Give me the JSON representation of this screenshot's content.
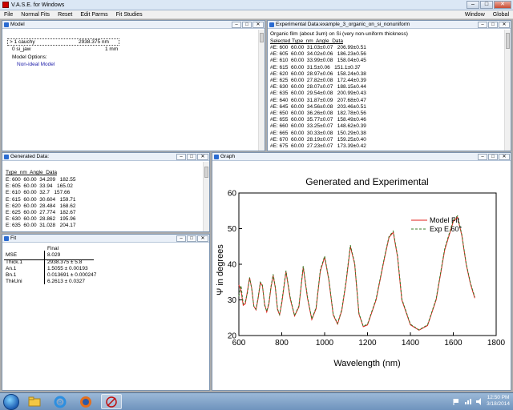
{
  "app": {
    "title": "V.A.S.E. for Windows",
    "min_label": "–",
    "max_label": "□",
    "close_label": "✕"
  },
  "menu": {
    "items": [
      "File",
      "Normal Fits",
      "Reset",
      "Edit Parms",
      "Fit Studies"
    ],
    "right": [
      "Window",
      "Global"
    ]
  },
  "pane_buttons": {
    "min": "–",
    "max": "□",
    "close": "✕"
  },
  "model": {
    "title": "Model",
    "rows": [
      {
        "label": "> 1 cauchy",
        "value": "2938.375 nm"
      },
      {
        "label": "0 si_jaw",
        "value": "1 mm"
      }
    ],
    "options_label": "Model Options:",
    "option": "Non-ideal Model"
  },
  "experimental": {
    "title": "Experimental Data:example_3_organic_on_si_nonuniform",
    "subtitle": "Organic film (about 3um) on Si (very non-uniform thickness)",
    "header": "Selected Type  nm  Angle  Data",
    "rows": [
      "#E: 600  60.00  31.03±0.07   206.99±0.51",
      "#E: 605  60.00  34.02±0.06   186.23±0.56",
      "#E: 610  60.00  33.99±0.08   158.04±0.45",
      "#E: 615  60.00  31.5±0.06   151.1±0.37",
      "#E: 620  60.00  28.97±0.06   158.24±0.38",
      "#E: 625  60.00  27.82±0.08   172.44±0.39",
      "#E: 630  60.00  28.07±0.07   188.15±0.44",
      "#E: 635  60.00  29.54±0.08   200.99±0.43",
      "#E: 640  60.00  31.87±0.09   207.68±0.47",
      "#E: 645  60.00  34.56±0.08   203.46±0.51",
      "#E: 650  60.00  36.26±0.08   182.78±0.56",
      "#E: 655  60.00  35.77±0.07   158.49±0.46",
      "#E: 660  60.00  33.25±0.07   148.62±0.39",
      "#E: 665  60.00  30.33±0.08   150.29±0.38",
      "#E: 670  60.00  28.19±0.07   159.25±0.40",
      "#E: 675  60.00  27.23±0.07   173.39±0.42"
    ]
  },
  "generated": {
    "title": "Generated Data:",
    "header": "Type  nm  Angle  Data",
    "rows": [
      "E: 600  60.00  34.209   182.55",
      "E: 605  60.00  33.94   165.02",
      "E: 610  60.00  32.7   157.66",
      "E: 615  60.00  30.604   159.71",
      "E: 620  60.00  28.484   168.62",
      "E: 625  60.00  27.774   182.67",
      "E: 630  60.00  28.862   195.96",
      "E: 635  60.00  31.028   204.17"
    ]
  },
  "fit": {
    "title": "Fit",
    "col_header": "Final",
    "rows": [
      {
        "name": "MSE",
        "value": "8.029"
      },
      {
        "name": "Thick.1",
        "value": "2938.375 ± 5.8"
      },
      {
        "name": "An.1",
        "value": "1.5055 ± 0.00193"
      },
      {
        "name": "Bn.1",
        "value": "0.013691 ± 0.000247"
      },
      {
        "name": "ThkUni",
        "value": "6.2613 ± 0.0327"
      }
    ]
  },
  "graph": {
    "title": "Graph"
  },
  "chart_data": {
    "type": "line",
    "title": "Generated and Experimental",
    "xlabel": "Wavelength (nm)",
    "ylabel": "Ψ in degrees",
    "xlim": [
      600,
      1800
    ],
    "ylim": [
      20,
      60
    ],
    "xticks": [
      600,
      800,
      1000,
      1200,
      1400,
      1600,
      1800
    ],
    "yticks": [
      20,
      30,
      40,
      50,
      60
    ],
    "legend_position": "right",
    "series": [
      {
        "name": "Model Fit",
        "style": "solid",
        "color": "#e0201c",
        "x": [
          600,
          610,
          620,
          630,
          640,
          650,
          660,
          670,
          680,
          690,
          700,
          710,
          720,
          730,
          740,
          750,
          760,
          770,
          780,
          790,
          800,
          820,
          840,
          860,
          880,
          900,
          920,
          940,
          960,
          980,
          1000,
          1020,
          1040,
          1060,
          1080,
          1100,
          1120,
          1140,
          1160,
          1180,
          1200,
          1240,
          1280,
          1300,
          1320,
          1340,
          1360,
          1400,
          1440,
          1480,
          1520,
          1560,
          1600,
          1620,
          1640,
          1660,
          1680,
          1700
        ],
        "y": [
          34.2,
          32.7,
          28.5,
          28.9,
          32.5,
          36.2,
          33.3,
          28.2,
          27.2,
          30.5,
          34.8,
          33.9,
          28.8,
          26.6,
          28.9,
          33.5,
          36.8,
          33.4,
          27.3,
          25.8,
          29,
          37.9,
          30.2,
          25.5,
          28,
          39.2,
          30.5,
          24.5,
          27.5,
          38,
          42,
          35.5,
          25.8,
          23.2,
          27,
          35,
          45,
          40,
          26,
          22.5,
          23,
          30,
          42,
          47.5,
          49,
          42,
          30,
          23,
          21.5,
          22.8,
          30,
          44,
          52,
          53.2,
          48,
          40,
          34.5,
          30.5
        ]
      },
      {
        "name": "Exp E 60°",
        "style": "dashed",
        "color": "#3a7d2a",
        "x": [
          600,
          610,
          620,
          630,
          640,
          650,
          660,
          670,
          680,
          690,
          700,
          710,
          720,
          730,
          740,
          750,
          760,
          770,
          780,
          790,
          800,
          820,
          840,
          860,
          880,
          900,
          920,
          940,
          960,
          980,
          1000,
          1020,
          1040,
          1060,
          1080,
          1100,
          1120,
          1140,
          1160,
          1180,
          1200,
          1240,
          1280,
          1300,
          1320,
          1340,
          1360,
          1400,
          1440,
          1480,
          1520,
          1560,
          1600,
          1620,
          1640,
          1660,
          1680,
          1700
        ],
        "y": [
          31,
          34,
          28.9,
          29.5,
          31.9,
          36.3,
          33.2,
          28.2,
          27.4,
          30.8,
          35,
          34.2,
          28.5,
          26.8,
          29.3,
          33.8,
          37.2,
          33.6,
          27.5,
          25.9,
          29.4,
          38.2,
          30.6,
          25.6,
          28.3,
          39.5,
          30.8,
          24.7,
          27.8,
          38.4,
          42.3,
          35.8,
          26,
          23.4,
          27.3,
          35.4,
          45.4,
          40.3,
          26.3,
          22.6,
          23.2,
          30.3,
          42.3,
          47.8,
          49.3,
          42.3,
          30.3,
          23.2,
          21.6,
          23,
          30.3,
          44.4,
          52.4,
          53.6,
          48.3,
          40.2,
          34.8,
          30.8
        ]
      }
    ]
  },
  "taskbar": {
    "time": "12:50 PM",
    "date": "3/18/2014"
  }
}
